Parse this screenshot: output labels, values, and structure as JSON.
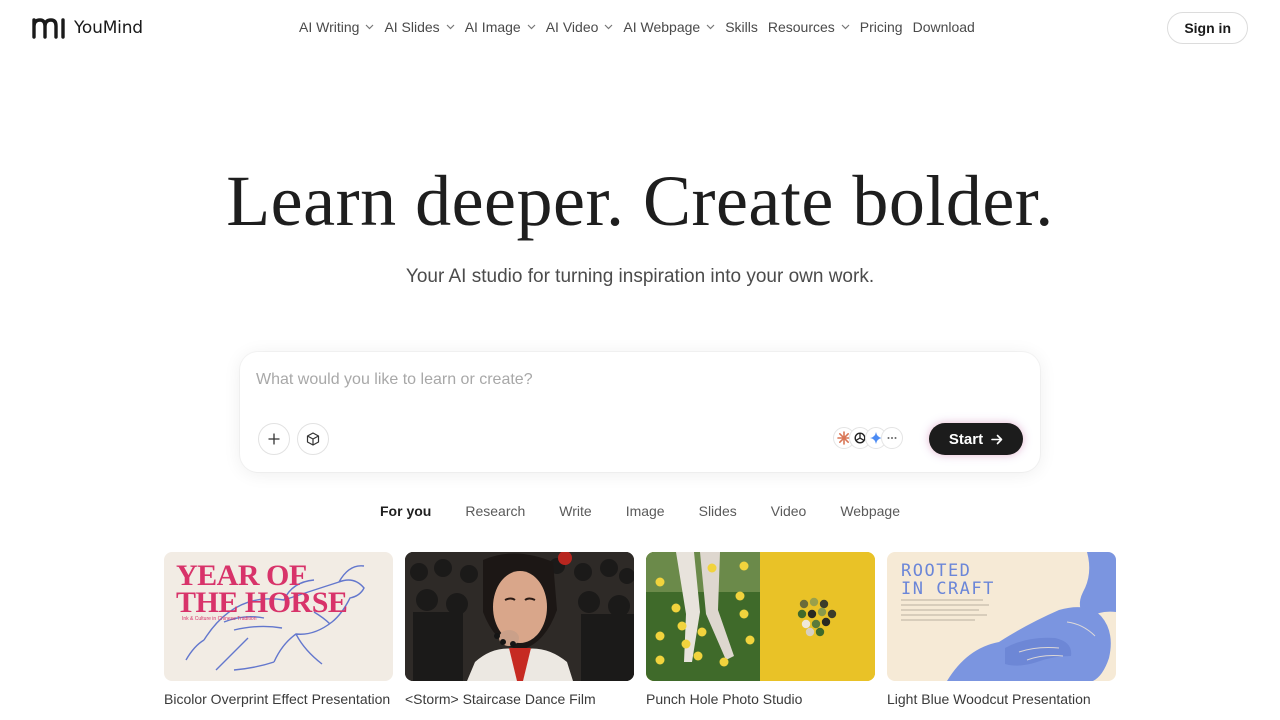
{
  "brand": {
    "name": "YouMind"
  },
  "nav": {
    "items": [
      {
        "label": "AI Writing",
        "dropdown": true
      },
      {
        "label": "AI Slides",
        "dropdown": true
      },
      {
        "label": "AI Image",
        "dropdown": true
      },
      {
        "label": "AI Video",
        "dropdown": true
      },
      {
        "label": "AI Webpage",
        "dropdown": true
      },
      {
        "label": "Skills",
        "dropdown": false
      },
      {
        "label": "Resources",
        "dropdown": true
      },
      {
        "label": "Pricing",
        "dropdown": false
      },
      {
        "label": "Download",
        "dropdown": false
      }
    ],
    "signin_label": "Sign in"
  },
  "hero": {
    "title": "Learn deeper. Create bolder.",
    "subtitle": "Your AI studio for turning inspiration into your own work."
  },
  "prompt": {
    "placeholder": "What would you like to learn or create?",
    "value": "",
    "start_label": "Start",
    "models": [
      "claude-icon",
      "openai-icon",
      "gemini-icon",
      "more-icon"
    ]
  },
  "tabs": [
    {
      "label": "For you",
      "active": true
    },
    {
      "label": "Research",
      "active": false
    },
    {
      "label": "Write",
      "active": false
    },
    {
      "label": "Image",
      "active": false
    },
    {
      "label": "Slides",
      "active": false
    },
    {
      "label": "Video",
      "active": false
    },
    {
      "label": "Webpage",
      "active": false
    }
  ],
  "cards": [
    {
      "title": "Bicolor Overprint Effect Presentation",
      "thumb_text": "YEAR OF THE HORSE",
      "thumb_small": "Ink & Culture in Chinese Tradition"
    },
    {
      "title": "<Storm> Staircase Dance Film"
    },
    {
      "title": "Punch Hole Photo Studio"
    },
    {
      "title": "Light Blue Woodcut Presentation",
      "thumb_text": "ROOTED IN CRAFT"
    }
  ],
  "colors": {
    "accent_dark": "#1c1c1c",
    "horse_pink": "#d8336a",
    "woodcut_blue": "#6b86d8",
    "punch_yellow": "#e9c227"
  }
}
